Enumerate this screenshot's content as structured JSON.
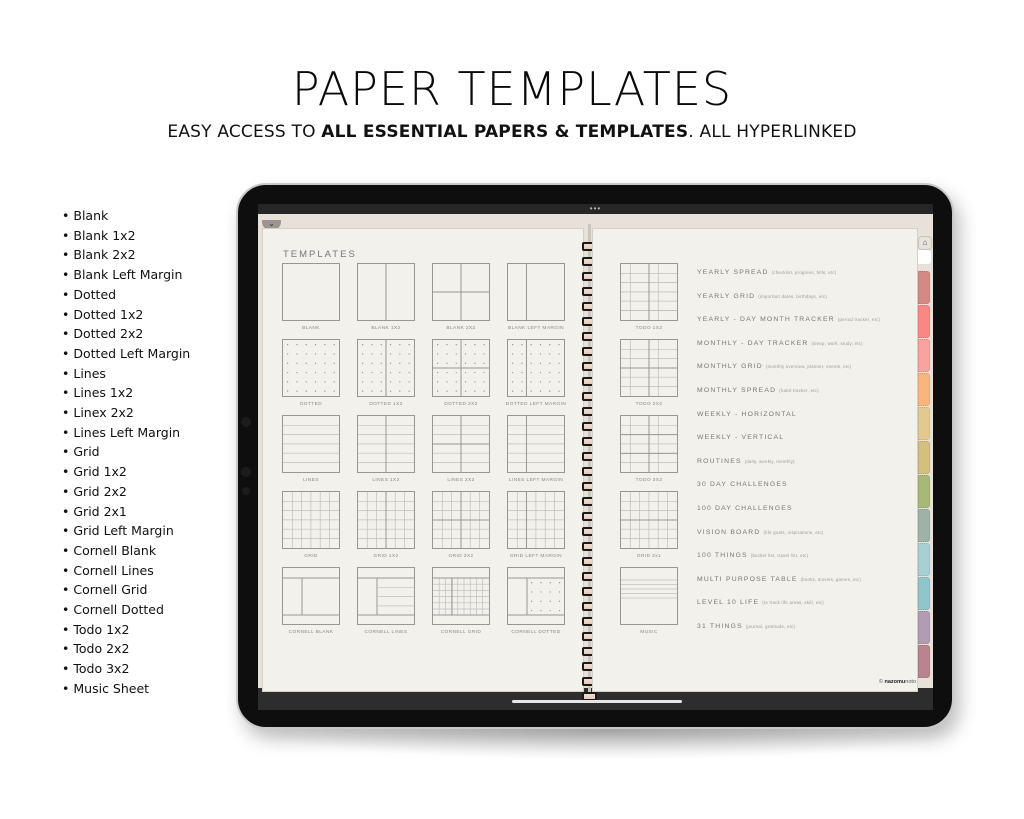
{
  "header": {
    "title": "PAPER TEMPLATES",
    "subtitle_prefix": "EASY ACCESS TO ",
    "subtitle_bold": "ALL ESSENTIAL PAPERS & TEMPLATES",
    "subtitle_suffix": ". ALL HYPERLINKED"
  },
  "feature_list": [
    "Blank",
    "Blank 1x2",
    "Blank 2x2",
    "Blank Left Margin",
    "Dotted",
    "Dotted 1x2",
    "Dotted 2x2",
    "Dotted Left Margin",
    "Lines",
    "Lines 1x2",
    "Linex 2x2",
    "Lines Left Margin",
    "Grid",
    "Grid 1x2",
    "Grid 2x2",
    "Grid 2x1",
    "Grid Left Margin",
    "Cornell Blank",
    "Cornell Lines",
    "Cornell Grid",
    "Cornell Dotted",
    "Todo 1x2",
    "Todo 2x2",
    "Todo 3x2",
    "Music Sheet"
  ],
  "tablet": {
    "status_dots": "•••",
    "collapse_icon": "⌄",
    "home_icon": "⌂",
    "brand_prefix": "© ",
    "brand_bold": "nazomu",
    "brand_suffix": "noto"
  },
  "left_page": {
    "heading": "TEMPLATES",
    "templates": [
      {
        "label": "BLANK",
        "kind": "blank"
      },
      {
        "label": "BLANK 1X2",
        "kind": "blank-1x2"
      },
      {
        "label": "BLANK 2X2",
        "kind": "blank-2x2"
      },
      {
        "label": "BLANK LEFT MARGIN",
        "kind": "blank-margin"
      },
      {
        "label": "DOTTED",
        "kind": "dotted"
      },
      {
        "label": "DOTTED 1X2",
        "kind": "dotted-1x2"
      },
      {
        "label": "DOTTED 2X2",
        "kind": "dotted-2x2"
      },
      {
        "label": "DOTTED LEFT MARGIN",
        "kind": "dotted-margin"
      },
      {
        "label": "LINES",
        "kind": "lines"
      },
      {
        "label": "LINES 1X2",
        "kind": "lines-1x2"
      },
      {
        "label": "LINES 2X2",
        "kind": "lines-2x2"
      },
      {
        "label": "LINES LEFT MARGIN",
        "kind": "lines-margin"
      },
      {
        "label": "GRID",
        "kind": "grid"
      },
      {
        "label": "GRID 1X2",
        "kind": "grid-1x2"
      },
      {
        "label": "GRID 2X2",
        "kind": "grid-2x2"
      },
      {
        "label": "GRID LEFT MARGIN",
        "kind": "grid-margin"
      },
      {
        "label": "CORNELL BLANK",
        "kind": "cornell-blank"
      },
      {
        "label": "CORNELL LINES",
        "kind": "cornell-lines"
      },
      {
        "label": "CORNELL GRID",
        "kind": "cornell-grid"
      },
      {
        "label": "CORNELL DOTTED",
        "kind": "cornell-dotted"
      }
    ]
  },
  "right_page": {
    "templates": [
      {
        "label": "TODO 1X2",
        "kind": "todo-1x2"
      },
      {
        "label": "TODO 2X2",
        "kind": "todo-2x2"
      },
      {
        "label": "TODO 3X2",
        "kind": "todo-3x2"
      },
      {
        "label": "GRID 2x1",
        "kind": "grid-2x1"
      },
      {
        "label": "MUSIC",
        "kind": "music"
      }
    ],
    "menu": [
      {
        "label": "YEARLY SPREAD",
        "hint": "(checklist, progress, bills, etc)"
      },
      {
        "label": "YEARLY GRID",
        "hint": "(important dates, birthdays, etc)"
      },
      {
        "label": "YEARLY - DAY MONTH TRACKER",
        "hint": "(period tracker, etc)"
      },
      {
        "label": "MONTHLY - DAY TRACKER",
        "hint": "(sleep, work, study, etc)"
      },
      {
        "label": "MONTHLY GRID",
        "hint": "(monthly overview, planner, events, etc)"
      },
      {
        "label": "MONTHLY SPREAD",
        "hint": "(habit tracker, etc)"
      },
      {
        "label": "WEEKLY - HORIZONTAL",
        "hint": ""
      },
      {
        "label": "WEEKLY - VERTICAL",
        "hint": ""
      },
      {
        "label": "ROUTINES",
        "hint": "(daily, weekly, monthly)"
      },
      {
        "label": "30 DAY CHALLENGES",
        "hint": ""
      },
      {
        "label": "100 DAY CHALLENGES",
        "hint": ""
      },
      {
        "label": "VISION BOARD",
        "hint": "(life goals, inspirations, etc)"
      },
      {
        "label": "100 THINGS",
        "hint": "(bucket list, travel list, etc)"
      },
      {
        "label": "MULTI PURPOSE TABLE",
        "hint": "(books, movies, games, etc)"
      },
      {
        "label": "LEVEL 10 LIFE",
        "hint": "(to track life areas, skill, etc)"
      },
      {
        "label": "31 THINGS",
        "hint": "(journal, gratitude, etc)"
      }
    ]
  },
  "tabs": [
    {
      "name": "tab-1",
      "color": "#d38a84"
    },
    {
      "name": "tab-2",
      "color": "#f98885"
    },
    {
      "name": "tab-3",
      "color": "#f9a29e"
    },
    {
      "name": "tab-4",
      "color": "#f9b57b"
    },
    {
      "name": "tab-5",
      "color": "#e3c98f"
    },
    {
      "name": "tab-6",
      "color": "#d5bf7e"
    },
    {
      "name": "tab-7",
      "color": "#a8b878"
    },
    {
      "name": "tab-8",
      "color": "#9eb2a8"
    },
    {
      "name": "tab-9",
      "color": "#a8d0d4"
    },
    {
      "name": "tab-10",
      "color": "#8fc6cc"
    },
    {
      "name": "tab-11",
      "color": "#b09db4"
    },
    {
      "name": "tab-12",
      "color": "#b9848f"
    }
  ]
}
